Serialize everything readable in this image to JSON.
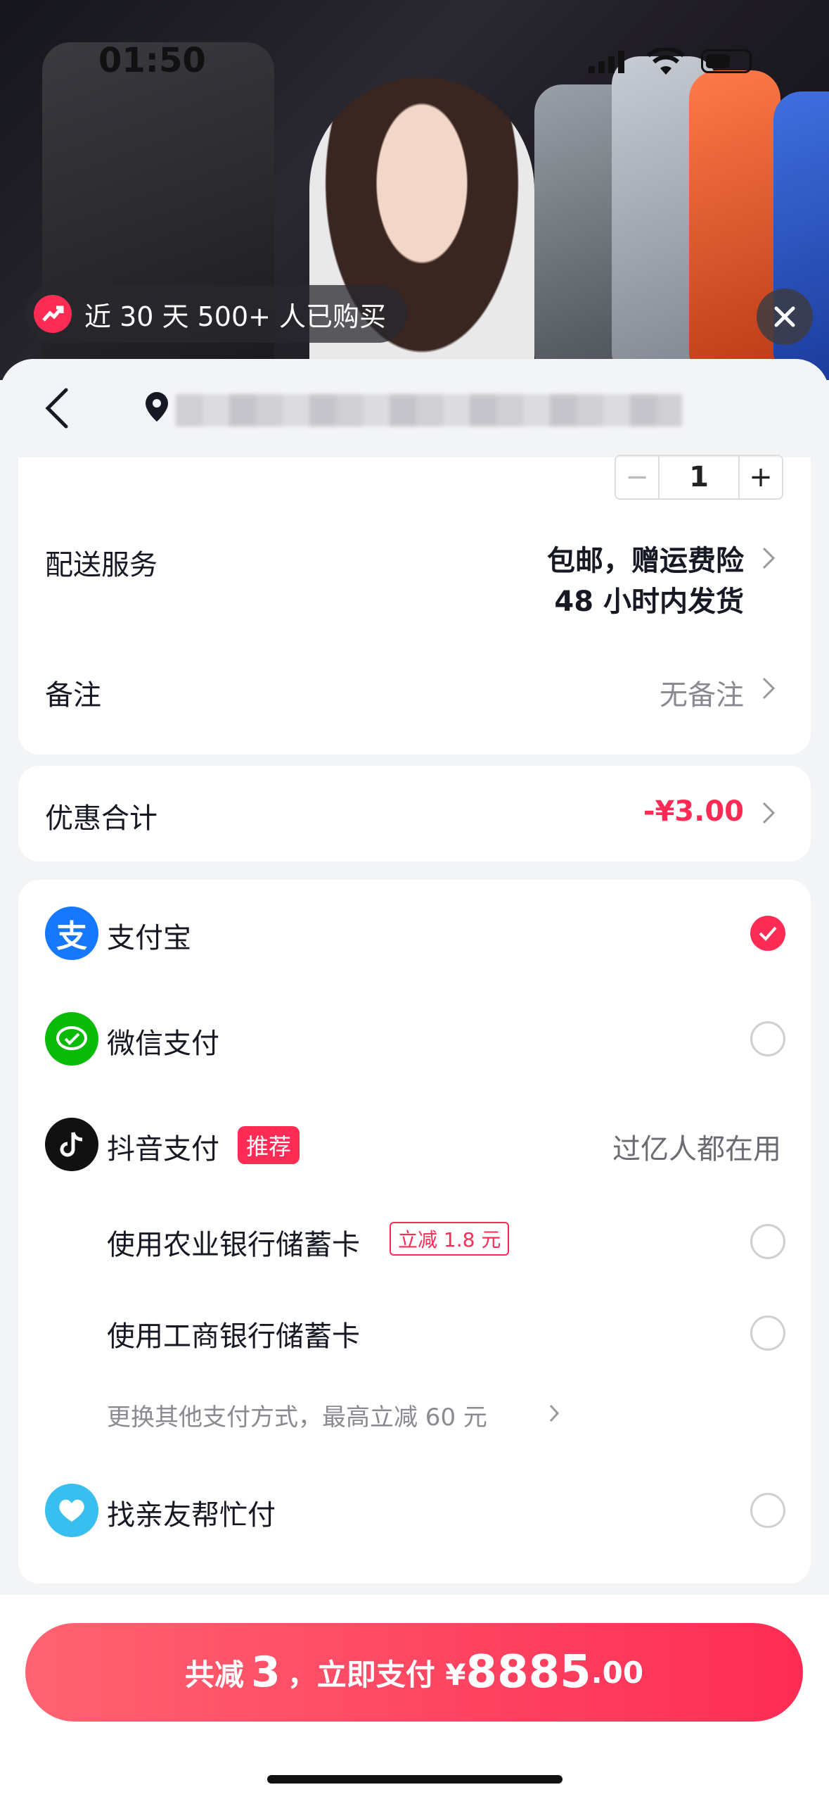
{
  "status": {
    "time": "01:50"
  },
  "video": {
    "promo_text": "近 30 天 500+ 人已购买"
  },
  "order": {
    "quantity": "1",
    "delivery_label": "配送服务",
    "delivery_value_line1": "包邮，赠运费险",
    "delivery_value_line2": "48 小时内发货",
    "remark_label": "备注",
    "remark_value": "无备注",
    "discount_label": "优惠合计",
    "discount_value": "-¥3.00"
  },
  "payment": {
    "alipay": "支付宝",
    "wechat": "微信支付",
    "douyin": "抖音支付",
    "douyin_tag": "推荐",
    "douyin_note": "过亿人都在用",
    "abc_card": "使用农业银行储蓄卡",
    "abc_tag": "立减 1.8 元",
    "icbc_card": "使用工商银行储蓄卡",
    "more_methods": "更换其他支付方式，最高立减 60 元",
    "friend_pay": "找亲友帮忙付",
    "selected": "alipay"
  },
  "pay_button": {
    "prefix": "共减",
    "saved": "3",
    "middle": "，立即支付 ¥",
    "amount_int": "8885",
    "amount_dec": ".00"
  },
  "colors": {
    "accent": "#fe2c55",
    "alipay": "#1677ff",
    "wechat": "#09bb07"
  }
}
